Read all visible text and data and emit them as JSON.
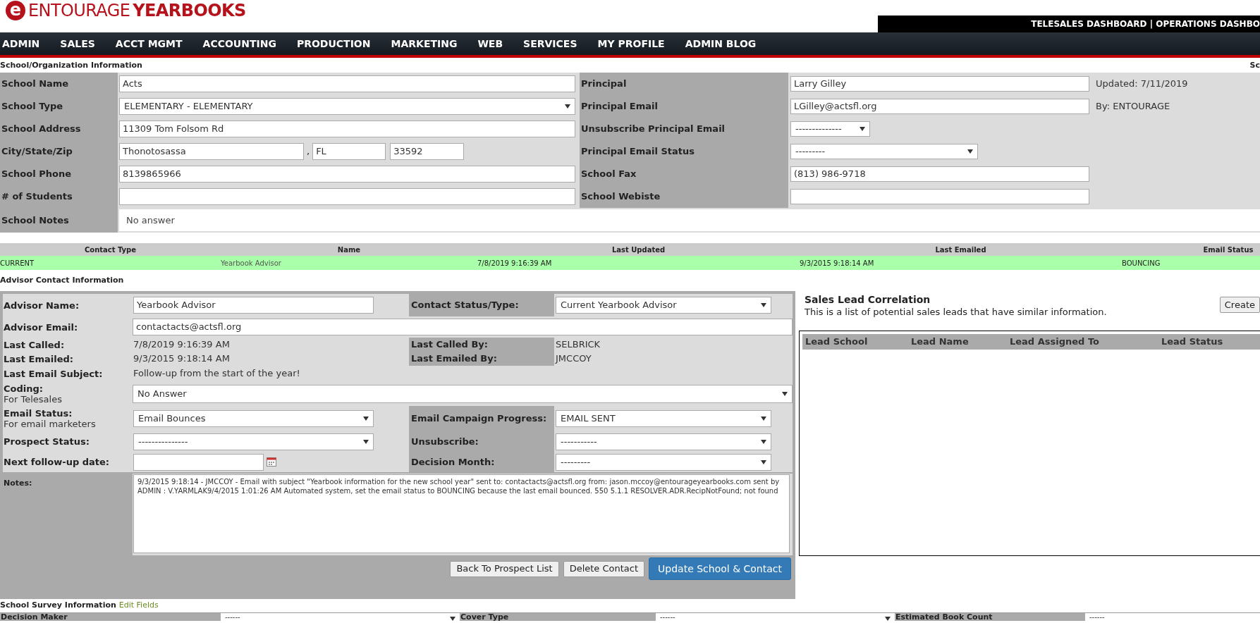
{
  "header": {
    "logo": {
      "mark": "e",
      "word1": "ENTOURAGE",
      "word2": "YEARBOOKS"
    },
    "dashboard_links": "TELESALES DASHBOARD | OPERATIONS DASHBO"
  },
  "nav": [
    "ADMIN",
    "SALES",
    "ACCT MGMT",
    "ACCOUNTING",
    "PRODUCTION",
    "MARKETING",
    "WEB",
    "SERVICES",
    "MY PROFILE",
    "ADMIN BLOG"
  ],
  "school": {
    "title": "School/Organization Information",
    "title_right": "Sc",
    "rows": [
      {
        "left": {
          "label": "School Name",
          "kind": "text",
          "value": "Acts"
        },
        "right": {
          "label": "Principal",
          "kind": "text",
          "value": "Larry Gilley"
        },
        "aside": "Updated: 7/11/2019"
      },
      {
        "left": {
          "label": "School Type",
          "kind": "select",
          "value": "ELEMENTARY - ELEMENTARY"
        },
        "right": {
          "label": "Principal Email",
          "kind": "text",
          "value": "LGilley@actsfl.org"
        },
        "aside": "By: ENTOURAGE"
      },
      {
        "left": {
          "label": "School Address",
          "kind": "text",
          "value": "11309 Tom Folsom Rd"
        },
        "right": {
          "label": "Unsubscribe Principal Email",
          "kind": "select",
          "value": "--------------"
        }
      },
      {
        "left": {
          "label": "City/State/Zip",
          "kind": "city",
          "city": "Thonotosassa",
          "separator": ",",
          "state": "FL",
          "zip": "33592"
        },
        "right": {
          "label": "Principal Email Status",
          "kind": "select",
          "value": "---------"
        }
      },
      {
        "left": {
          "label": "School Phone",
          "kind": "text",
          "value": "8139865966"
        },
        "right": {
          "label": "School Fax",
          "kind": "text",
          "value": "(813) 986-9718"
        }
      },
      {
        "left": {
          "label": "# of Students",
          "kind": "text"
        },
        "right": {
          "label": "School Webiste",
          "kind": "text"
        }
      },
      {
        "left": {
          "label": "School Notes",
          "kind": "notes",
          "value": "No answer"
        }
      }
    ]
  },
  "contacts": {
    "columns": [
      "Contact Type",
      "Name",
      "Last Updated",
      "Last Emailed",
      "Email Status"
    ],
    "rows": [
      {
        "selected": true,
        "cells": [
          "CURRENT",
          "Yearbook Advisor",
          "7/8/2019 9:16:39 AM",
          "9/3/2015 9:18:14 AM",
          "BOUNCING"
        ]
      }
    ]
  },
  "advisor": {
    "title": "Advisor Contact Information",
    "rows": [
      {
        "left": {
          "label": "Advisor Name:",
          "kind": "text",
          "value": "Yearbook Advisor"
        },
        "right": {
          "label": "Contact Status/Type:",
          "kind": "select",
          "value": "Current Yearbook Advisor"
        }
      },
      {
        "left": {
          "label": "Advisor Email:",
          "kind": "wide_text",
          "value": "contactacts@actsfl.org"
        }
      },
      {
        "left": {
          "label": "Last Called:",
          "kind": "plain",
          "value": "7/8/2019 9:16:39 AM"
        },
        "right": {
          "label": "Last Called By:",
          "kind": "plain",
          "value": "SELBRICK"
        }
      },
      {
        "left": {
          "label": "Last Emailed:",
          "kind": "plain",
          "value": "9/3/2015 9:18:14 AM"
        },
        "right": {
          "label": "Last Emailed By:",
          "kind": "plain",
          "value": "JMCCOY"
        }
      },
      {
        "left": {
          "label": "Last Email Subject:",
          "kind": "plain",
          "value": "Follow-up from the start of the year!"
        }
      },
      {
        "left": {
          "label": "Coding:",
          "sublabel": "For Telesales",
          "kind": "wide_select",
          "value": "No Answer"
        }
      },
      {
        "left": {
          "label": "Email Status:",
          "sublabel": "For email marketers",
          "kind": "select",
          "value": "Email Bounces"
        },
        "right": {
          "label": "Email Campaign Progress:",
          "kind": "select",
          "value": "EMAIL SENT"
        }
      },
      {
        "left": {
          "label": "Prospect Status:",
          "kind": "select",
          "value": "---------------"
        },
        "right": {
          "label": "Unsubscribe:",
          "kind": "select",
          "value": "-----------"
        }
      },
      {
        "left": {
          "label": "Next follow-up date:",
          "kind": "date"
        },
        "right": {
          "label": "Decision Month:",
          "kind": "select",
          "value": "---------"
        }
      }
    ],
    "notes": {
      "label": "Notes:",
      "value": "9/3/2015 9:18:14 - JMCCOY - Email with subject \"Yearbook information for the new school year\" sent to: contactacts@actsfl.org from: jason.mccoy@entourageyearbooks.com sent by ADMIN : V.YARMLAK9/4/2015 1:01:26 AM Automated system, set the email status to BOUNCING because the last email bounced. 550 5.1.1 RESOLVER.ADR.RecipNotFound; not found"
    },
    "buttons": [
      {
        "label": "Back To Prospect List",
        "kind": "default"
      },
      {
        "label": "Delete Contact",
        "kind": "default"
      },
      {
        "label": "Update School & Contact",
        "kind": "primary"
      }
    ]
  },
  "sales_leads": {
    "title": "Sales Lead Correlation",
    "description": "This is a list of potential sales leads that have similar information.",
    "create_button": "Create",
    "columns": [
      "Lead School",
      "Lead Name",
      "Lead Assigned To",
      "Lead Status"
    ]
  },
  "survey": {
    "title": "School Survey Information",
    "edit_link": "Edit Fields",
    "fields": [
      {
        "label": "Decision Maker",
        "kind": "select",
        "value": "------"
      },
      {
        "label": "Cover Type",
        "kind": "select",
        "value": "------"
      },
      {
        "label": "Estimated Book Count",
        "kind": "text",
        "value": "------"
      }
    ]
  }
}
